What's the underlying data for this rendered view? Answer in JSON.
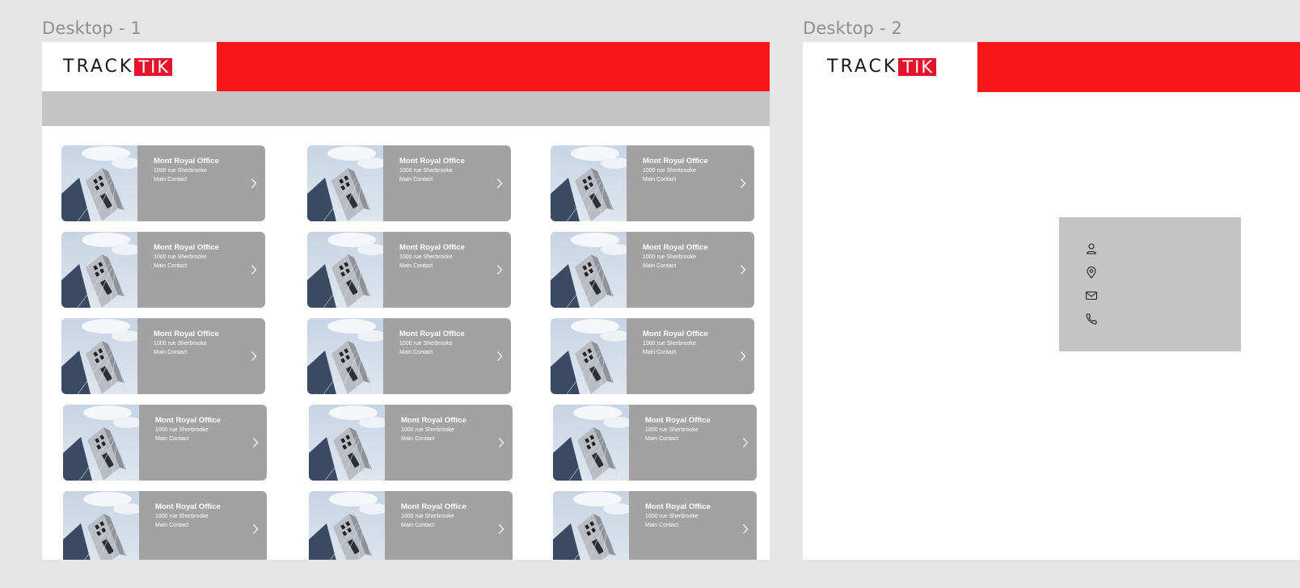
{
  "frames": {
    "desktop1_label": "Desktop - 1",
    "desktop2_label": "Desktop - 2"
  },
  "logo": {
    "part1": "TRACK",
    "part2": "TIK"
  },
  "colors": {
    "brand_red": "#f7171a",
    "logo_red": "#e3142b",
    "card_bg": "#a2a2a2",
    "strip_bg": "#c4c4c4"
  },
  "cards": [
    {
      "title": "Mont Royal Office",
      "address": "1000 rue Sherbrooke",
      "contact": "Main Contact"
    },
    {
      "title": "Mont Royal Office",
      "address": "1000 rue Sherbrooke",
      "contact": "Main Contact"
    },
    {
      "title": "Mont Royal Office",
      "address": "1000 rue Sherbrooke",
      "contact": "Main Contact"
    },
    {
      "title": "Mont Royal Office",
      "address": "1000 rue Sherbrooke",
      "contact": "Main Contact"
    },
    {
      "title": "Mont Royal Office",
      "address": "1000 rue Sherbrooke",
      "contact": "Main Contact"
    },
    {
      "title": "Mont Royal Office",
      "address": "1000 rue Sherbrooke",
      "contact": "Main Contact"
    },
    {
      "title": "Mont Royal Office",
      "address": "1000 rue Sherbrooke",
      "contact": "Main Contact"
    },
    {
      "title": "Mont Royal Office",
      "address": "1000 rue Sherbrooke",
      "contact": "Main Contact"
    },
    {
      "title": "Mont Royal Office",
      "address": "1000 rue Sherbrooke",
      "contact": "Main Contact"
    },
    {
      "title": "Mont Royal Office",
      "address": "1000 rue Sherbrooke",
      "contact": "Main Contact"
    },
    {
      "title": "Mont Royal Office",
      "address": "1000 rue Sherbrooke",
      "contact": "Main Contact"
    },
    {
      "title": "Mont Royal Office",
      "address": "1000 rue Sherbrooke",
      "contact": "Main Contact"
    },
    {
      "title": "Mont Royal Office",
      "address": "1000 rue Sherbrooke",
      "contact": "Main Contact"
    },
    {
      "title": "Mont Royal Office",
      "address": "1000 rue Sherbrooke",
      "contact": "Main Contact"
    },
    {
      "title": "Mont Royal Office",
      "address": "1000 rue Sherbrooke",
      "contact": "Main Contact"
    }
  ],
  "info_panel": {
    "icons": [
      "person-icon",
      "location-pin-icon",
      "mail-icon",
      "phone-icon"
    ]
  }
}
